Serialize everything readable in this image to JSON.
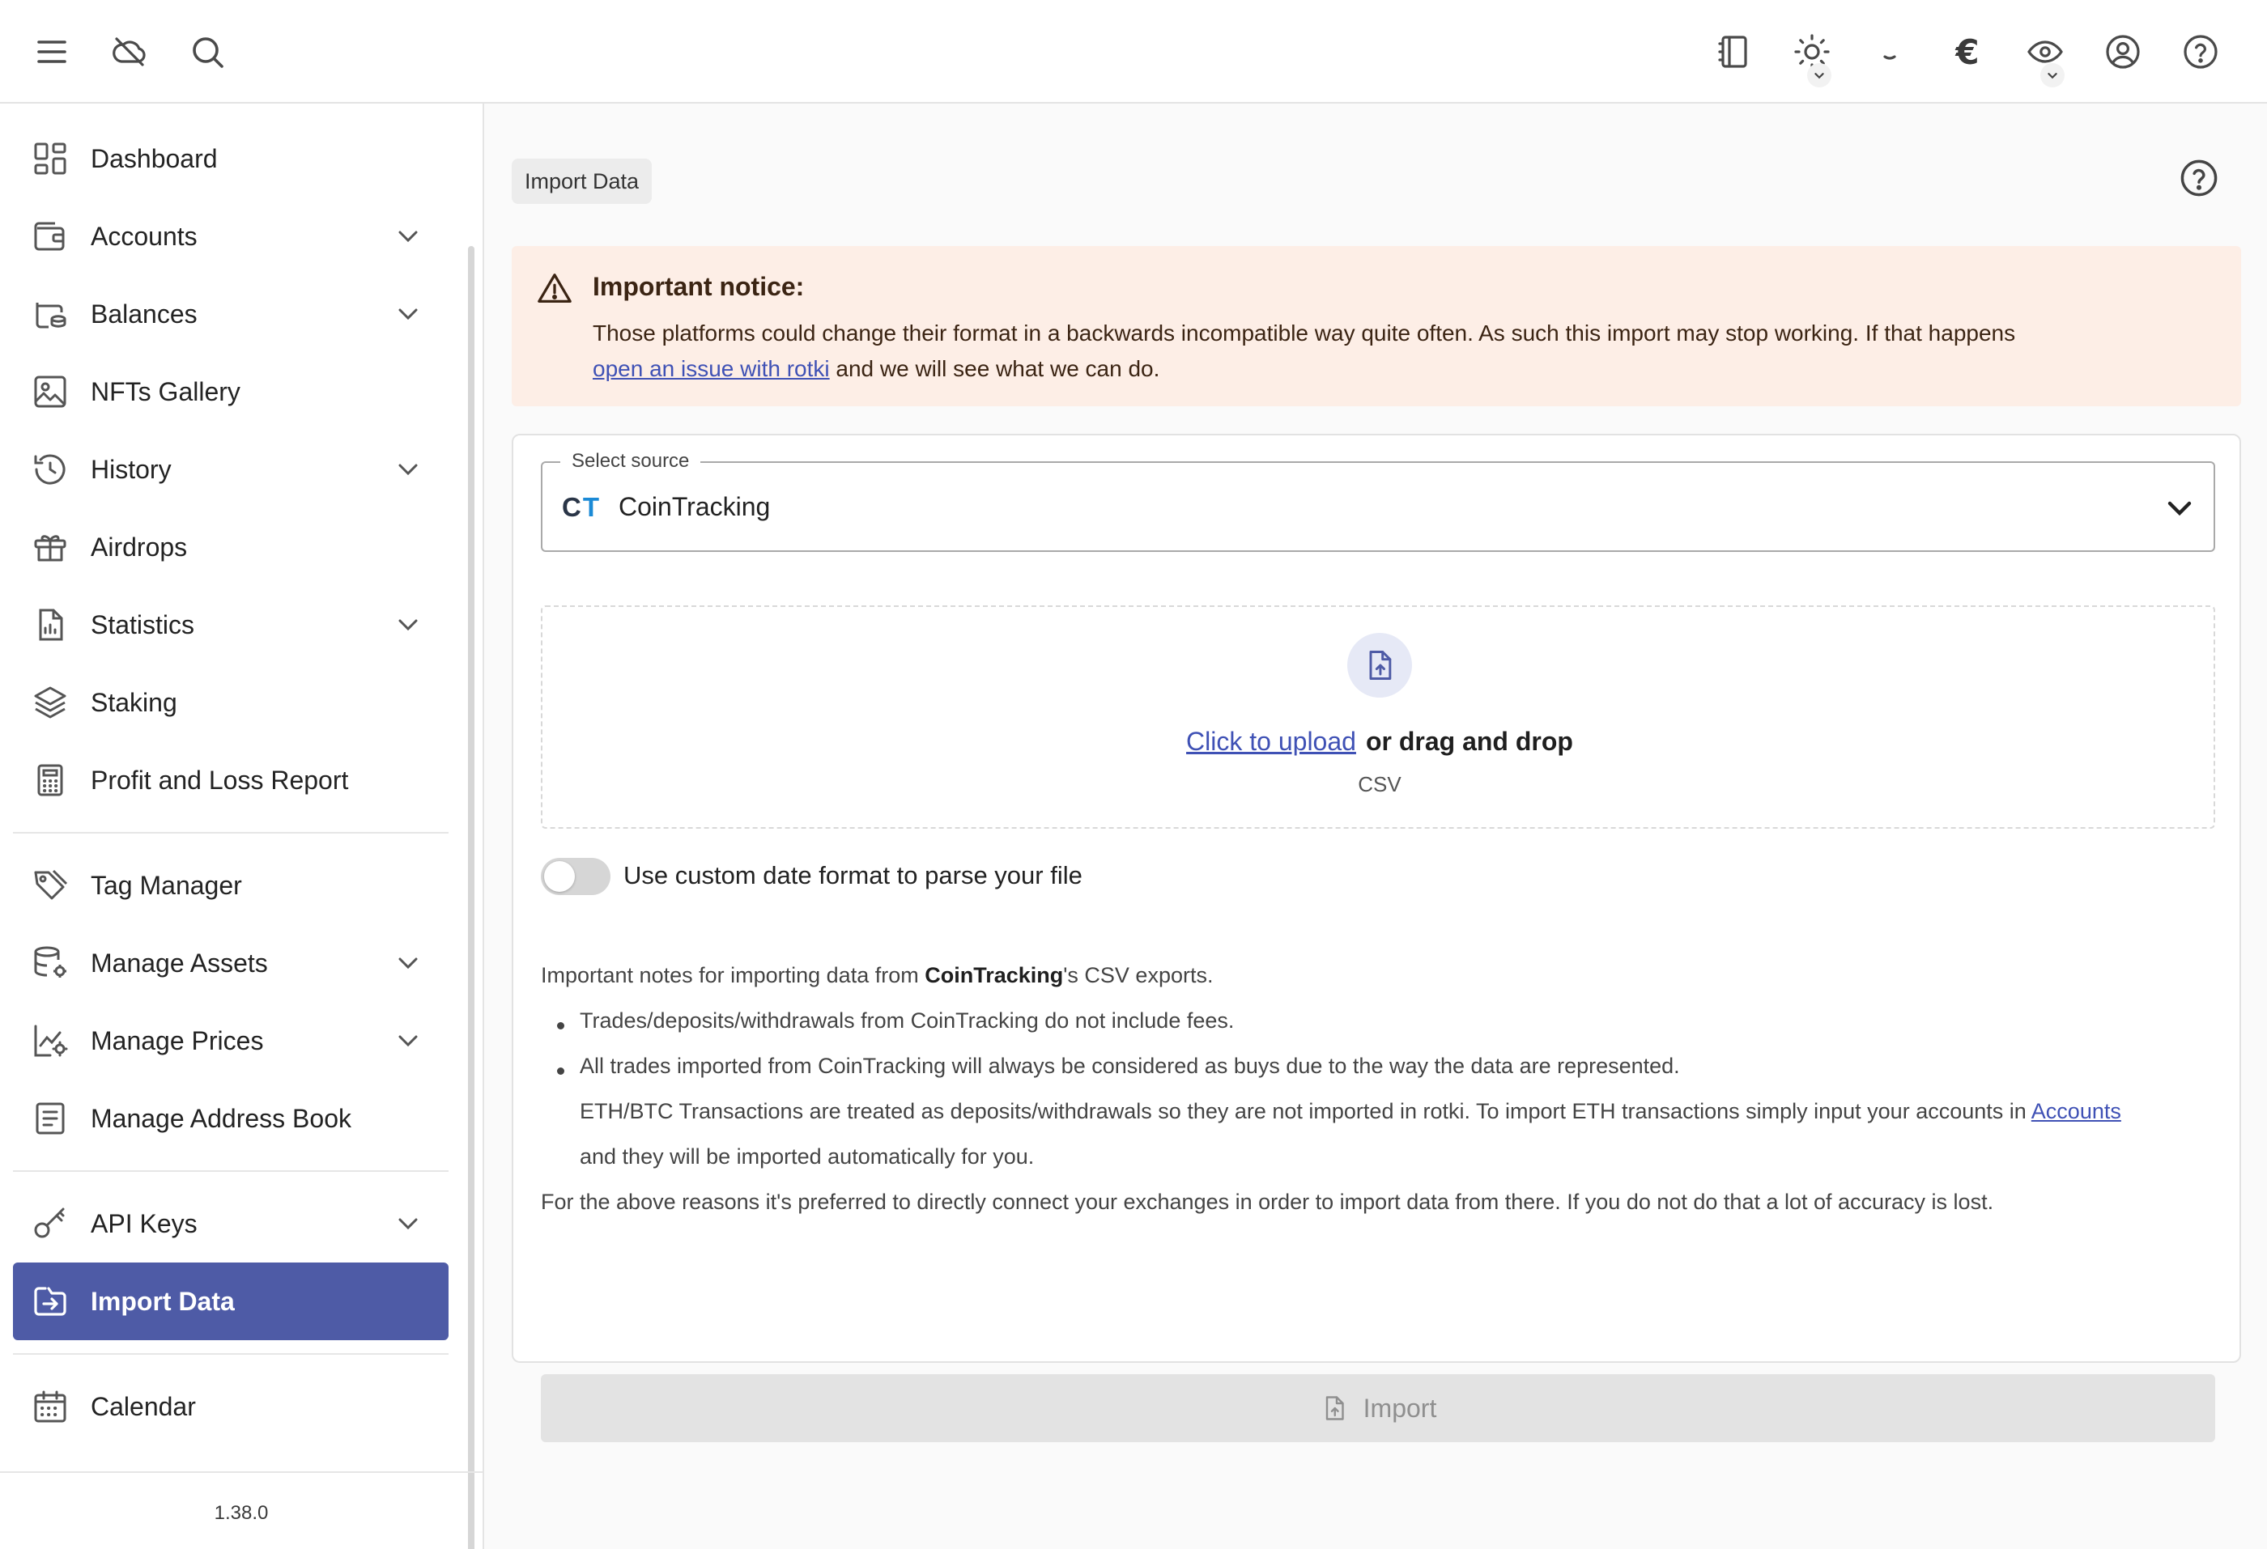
{
  "topbar": {
    "left_icons": [
      "menu-icon",
      "cloud-off-icon",
      "search-icon"
    ],
    "right_icons": [
      "notes-icon",
      "theme-sun-icon",
      "pin-icon",
      "currency-euro-icon",
      "privacy-eye-icon",
      "account-icon",
      "help-icon"
    ],
    "currency_symbol": "€"
  },
  "sidebar": {
    "items": [
      {
        "label": "Dashboard",
        "icon": "dashboard-icon",
        "expandable": false
      },
      {
        "label": "Accounts",
        "icon": "wallet-icon",
        "expandable": true
      },
      {
        "label": "Balances",
        "icon": "balances-icon",
        "expandable": true
      },
      {
        "label": "NFTs Gallery",
        "icon": "image-icon",
        "expandable": false
      },
      {
        "label": "History",
        "icon": "history-icon",
        "expandable": true
      },
      {
        "label": "Airdrops",
        "icon": "gift-icon",
        "expandable": false
      },
      {
        "label": "Statistics",
        "icon": "statistics-icon",
        "expandable": true
      },
      {
        "label": "Staking",
        "icon": "stack-icon",
        "expandable": false
      },
      {
        "label": "Profit and Loss Report",
        "icon": "calculator-icon",
        "expandable": false
      },
      {
        "label": "Tag Manager",
        "icon": "tag-icon",
        "expandable": false
      },
      {
        "label": "Manage Assets",
        "icon": "database-gear-icon",
        "expandable": true
      },
      {
        "label": "Manage Prices",
        "icon": "price-chart-icon",
        "expandable": true
      },
      {
        "label": "Manage Address Book",
        "icon": "address-book-icon",
        "expandable": false
      },
      {
        "label": "API Keys",
        "icon": "key-icon",
        "expandable": true
      },
      {
        "label": "Import Data",
        "icon": "import-icon",
        "expandable": false,
        "active": true
      },
      {
        "label": "Calendar",
        "icon": "calendar-icon",
        "expandable": false
      }
    ],
    "version": "1.38.0"
  },
  "main": {
    "page_title": "Import Data",
    "notice": {
      "title": "Important notice:",
      "body": "Those platforms could change their format in a backwards incompatible way quite often. As such this import may stop working. If that happens",
      "link": "open an issue with rotki",
      "body_after": " and we will see what we can do."
    },
    "source_select": {
      "legend": "Select source",
      "logo_c": "C",
      "logo_t": "T",
      "value": "CoinTracking"
    },
    "upload": {
      "link": "Click to upload",
      "rest": "or drag and drop",
      "format": "CSV"
    },
    "custom_date_toggle": {
      "label": "Use custom date format to parse your file",
      "enabled": false
    },
    "notes": {
      "intro_before": "Important notes for importing data from ",
      "intro_bold": "CoinTracking",
      "intro_after": "'s CSV exports.",
      "bullet_1": "Trades/deposits/withdrawals from CoinTracking do not include fees.",
      "bullet_2": "All trades imported from CoinTracking will always be considered as buys due to the way the data are represented.",
      "sub_line_1": "ETH/BTC Transactions are treated as deposits/withdrawals so they are not imported in rotki. To import ETH transactions simply input your accounts in ",
      "sub_link": "Accounts",
      "sub_line_2": "and they will be imported automatically for you.",
      "footer": "For the above reasons it's preferred to directly connect your exchanges in order to import data from there. If you do not do that a lot of accuracy is lost."
    },
    "import_button": "Import"
  },
  "colors": {
    "accent": "#4e5ba6",
    "notice_bg": "#fdeee6",
    "link": "#3f51b5",
    "disabled_button": "#e3e3e3"
  }
}
